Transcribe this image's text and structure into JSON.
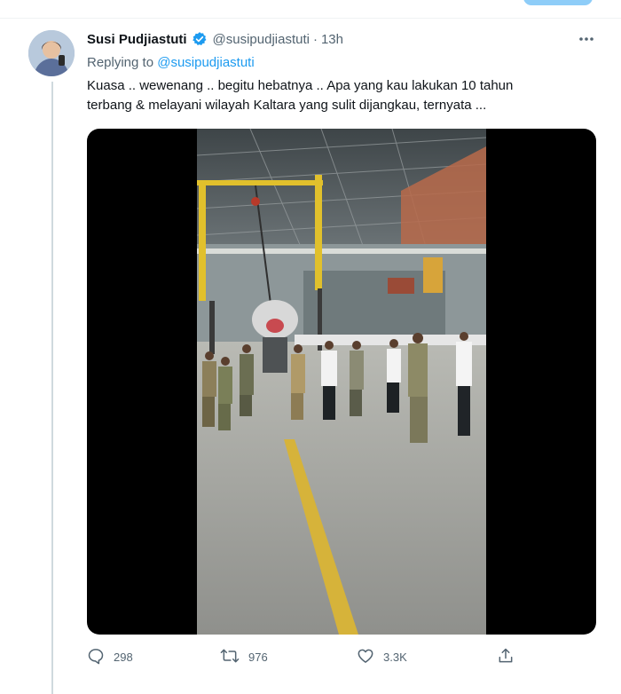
{
  "tweet": {
    "author_name": "Susi Pudjiastuti",
    "author_handle": "@susipudjiastuti",
    "separator": "·",
    "time": "13h",
    "replying_prefix": "Replying to",
    "replying_to": "@susipudjiastuti",
    "text_line1": "Kuasa .. wewenang .. begitu hebatnya .. Apa yang kau lakukan 10 tahun",
    "text_line2": "terbang & melayani wilayah Kaltara yang sulit dijangkau, ternyata ..."
  },
  "actions": {
    "replies": "298",
    "retweets": "976",
    "likes": "3.3K"
  },
  "icons": {
    "verified": "verified-badge-icon",
    "more": "more-icon",
    "reply": "reply-icon",
    "retweet": "retweet-icon",
    "like": "heart-icon",
    "share": "share-icon"
  },
  "colors": {
    "accent": "#1d9bf0",
    "secondary_text": "#536471",
    "primary_text": "#0f1419"
  }
}
